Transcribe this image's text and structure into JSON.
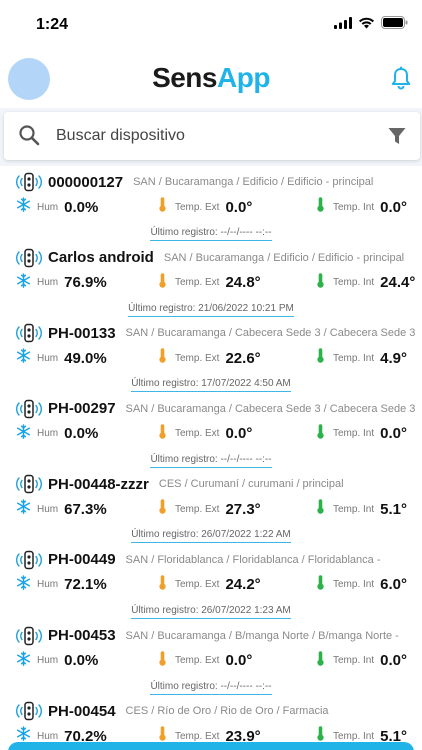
{
  "status_bar": {
    "time": "1:24"
  },
  "header": {
    "logo_part1": "Sens",
    "logo_part2": "App"
  },
  "search": {
    "placeholder": "Buscar dispositivo"
  },
  "colors": {
    "accent": "#1fb3e8",
    "humidity": "#1aa3e6",
    "temp_ext": "#f0a028",
    "temp_int": "#2bb34a",
    "avatar": "#b3d6f8"
  },
  "icons": {
    "sensor": "sensor-device-icon",
    "humidity": "snowflake-icon",
    "temp_ext": "thermometer-orange-icon",
    "temp_int": "thermometer-green-icon"
  },
  "labels": {
    "hum": "Hum",
    "temp_ext": "Temp. Ext",
    "temp_int": "Temp. Int"
  },
  "devices": [
    {
      "name": "000000127",
      "location": "SAN / Bucaramanga / Edificio / Edificio - principal",
      "hum": "0.0%",
      "temp_ext": "0.0°",
      "temp_int": "0.0°",
      "last": "Último registro: --/--/---- --:--"
    },
    {
      "name": "Carlos android",
      "location": "SAN / Bucaramanga / Edificio / Edificio - principal",
      "hum": "76.9%",
      "temp_ext": "24.8°",
      "temp_int": "24.4°",
      "last": "Último registro: 21/06/2022 10:21 PM"
    },
    {
      "name": "PH-00133",
      "location": "SAN / Bucaramanga / Cabecera Sede 3 / Cabecera Sede 3 -",
      "hum": "49.0%",
      "temp_ext": "22.6°",
      "temp_int": "4.9°",
      "last": "Último registro: 17/07/2022 4:50 AM"
    },
    {
      "name": "PH-00297",
      "location": "SAN / Bucaramanga / Cabecera Sede 3 / Cabecera Sede 3 -",
      "hum": "0.0%",
      "temp_ext": "0.0°",
      "temp_int": "0.0°",
      "last": "Último registro: --/--/---- --:--"
    },
    {
      "name": "PH-00448-zzzr",
      "location": "CES / Curumaní / curumani / principal",
      "hum": "67.3%",
      "temp_ext": "27.3°",
      "temp_int": "5.1°",
      "last": "Último registro: 26/07/2022 1:22 AM"
    },
    {
      "name": "PH-00449",
      "location": "SAN / Floridablanca / Floridablanca / Floridablanca -",
      "hum": "72.1%",
      "temp_ext": "24.2°",
      "temp_int": "6.0°",
      "last": "Último registro: 26/07/2022 1:23 AM"
    },
    {
      "name": "PH-00453",
      "location": "SAN / Bucaramanga / B/manga Norte / B/manga Norte -",
      "hum": "0.0%",
      "temp_ext": "0.0°",
      "temp_int": "0.0°",
      "last": "Último registro: --/--/---- --:--"
    },
    {
      "name": "PH-00454",
      "location": "CES / Río de Oro / Rio de Oro / Farmacia",
      "hum": "70.2%",
      "temp_ext": "23.9°",
      "temp_int": "5.1°",
      "last": ""
    }
  ]
}
